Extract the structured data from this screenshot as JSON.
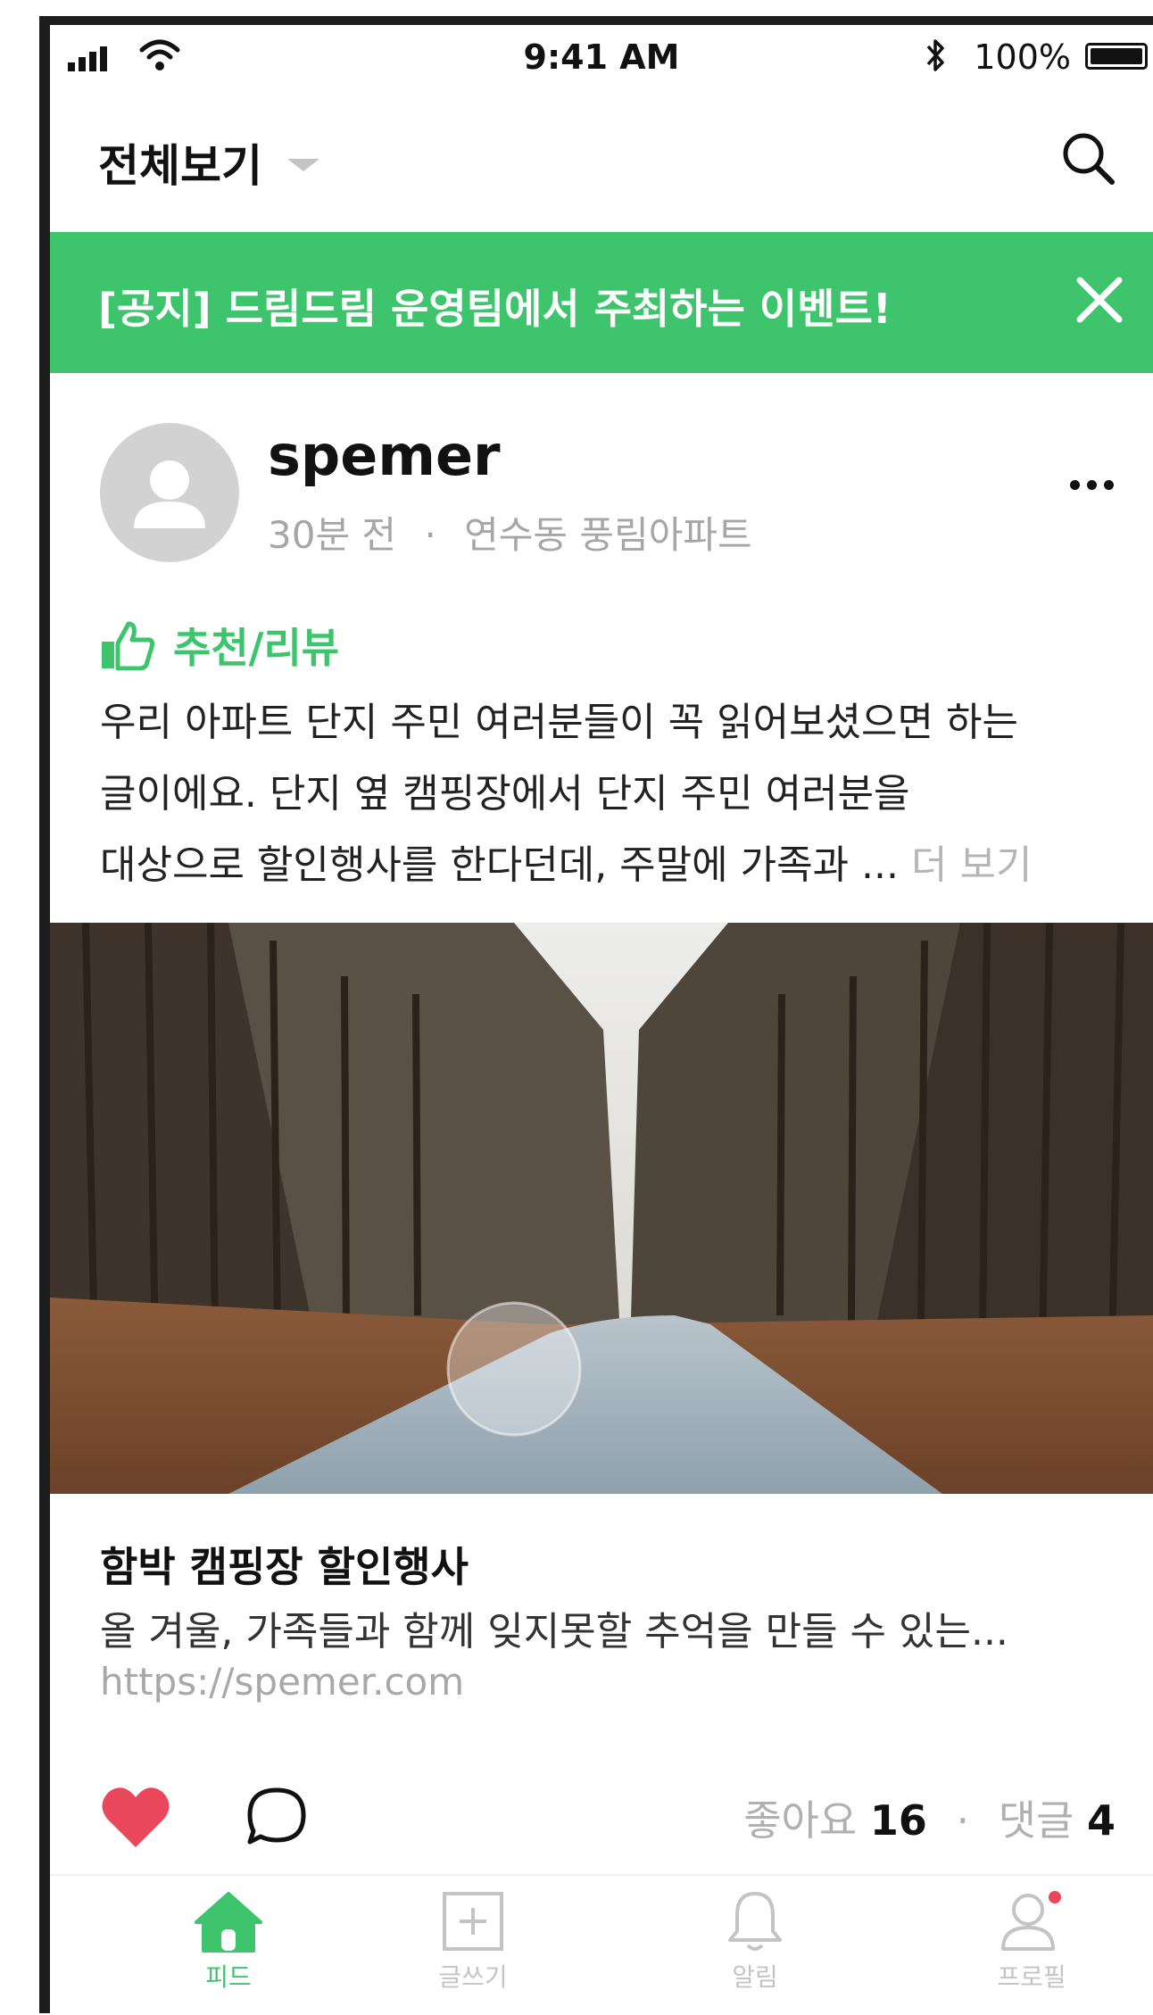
{
  "status_bar": {
    "time": "9:41 AM",
    "battery": "100%"
  },
  "header": {
    "filter_label": "전체보기"
  },
  "notice": {
    "text": "[공지] 드림드림 운영팀에서 주최하는 이벤트!"
  },
  "post": {
    "author": "spemer",
    "time_ago": "30분 전",
    "separator": "·",
    "location": "연수동 풍림아파트",
    "category": "추천/리뷰",
    "body_lines": [
      "우리 아파트 단지 주민 여러분들이 꼭 읽어보셨으면 하는",
      "글이에요. 단지 옆 캠핑장에서 단지 주민 여러분을",
      "대상으로 할인행사를 한다던데, 주말에 가족과 ..."
    ],
    "more_label": "더 보기",
    "link_preview": {
      "title": "함박 캠핑장 할인행사",
      "description": "올 겨울, 가족들과 함께 잊지못할 추억을 만들 수 있는...",
      "url": "https://spemer.com"
    },
    "likes_label": "좋아요",
    "likes_count": "16",
    "comments_label": "댓글",
    "comments_count": "4"
  },
  "tabbar": {
    "tabs": [
      {
        "label": "피드",
        "icon": "home-icon",
        "active": true
      },
      {
        "label": "글쓰기",
        "icon": "write-icon",
        "active": false
      },
      {
        "label": "알림",
        "icon": "bell-icon",
        "active": false
      },
      {
        "label": "프로필",
        "icon": "profile-icon",
        "active": false
      }
    ]
  },
  "colors": {
    "accent": "#3ec46d",
    "like": "#e8475c",
    "muted": "#a6a6a6"
  }
}
